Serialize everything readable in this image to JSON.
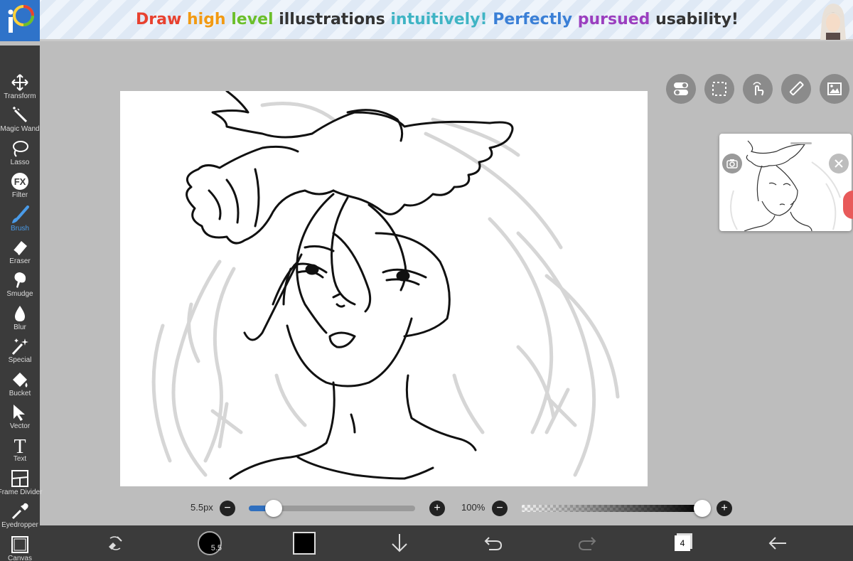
{
  "banner": {
    "segments": [
      {
        "text": "Draw ",
        "color": "#e8412f"
      },
      {
        "text": "high ",
        "color": "#f29a12"
      },
      {
        "text": "level ",
        "color": "#6bbf2a"
      },
      {
        "text": "illustrations ",
        "color": "#333333"
      },
      {
        "text": "intuitively! ",
        "color": "#3fb4c4"
      },
      {
        "text": "Perfectly ",
        "color": "#3a7fd6"
      },
      {
        "text": "pursued ",
        "color": "#9b3fbf"
      },
      {
        "text": "usability!",
        "color": "#333333"
      }
    ]
  },
  "toolbar": {
    "items": [
      {
        "label": "Transform",
        "icon": "move-arrows-icon"
      },
      {
        "label": "Magic Wand",
        "icon": "magic-wand-icon"
      },
      {
        "label": "Lasso",
        "icon": "lasso-icon"
      },
      {
        "label": "Filter",
        "icon": "fx-icon",
        "icon_text": "FX"
      },
      {
        "label": "Brush",
        "icon": "brush-icon",
        "active": true
      },
      {
        "label": "Eraser",
        "icon": "eraser-icon"
      },
      {
        "label": "Smudge",
        "icon": "smudge-icon"
      },
      {
        "label": "Blur",
        "icon": "blur-drop-icon"
      },
      {
        "label": "Special",
        "icon": "special-sparkle-icon"
      },
      {
        "label": "Bucket",
        "icon": "bucket-icon"
      },
      {
        "label": "Vector",
        "icon": "vector-cursor-icon"
      },
      {
        "label": "Text",
        "icon": "text-icon",
        "icon_text": "T"
      },
      {
        "label": "Frame Divider",
        "icon": "frame-divider-icon"
      },
      {
        "label": "Eyedropper",
        "icon": "eyedropper-icon"
      },
      {
        "label": "Canvas",
        "icon": "canvas-icon"
      }
    ],
    "active_color": "#4a9be8"
  },
  "sliders": {
    "size_label": "5.5px",
    "size_value_fraction": 0.1,
    "opacity_label": "100%",
    "opacity_value_fraction": 1.0,
    "minus": "−",
    "plus": "+"
  },
  "bottombar": {
    "brush_size": "5.5",
    "layer_count": "4",
    "primary_color": "#000000"
  },
  "top_buttons": [
    "toggle-icon",
    "selection-icon",
    "touch-gesture-icon",
    "ruler-icon",
    "image-reference-icon"
  ]
}
